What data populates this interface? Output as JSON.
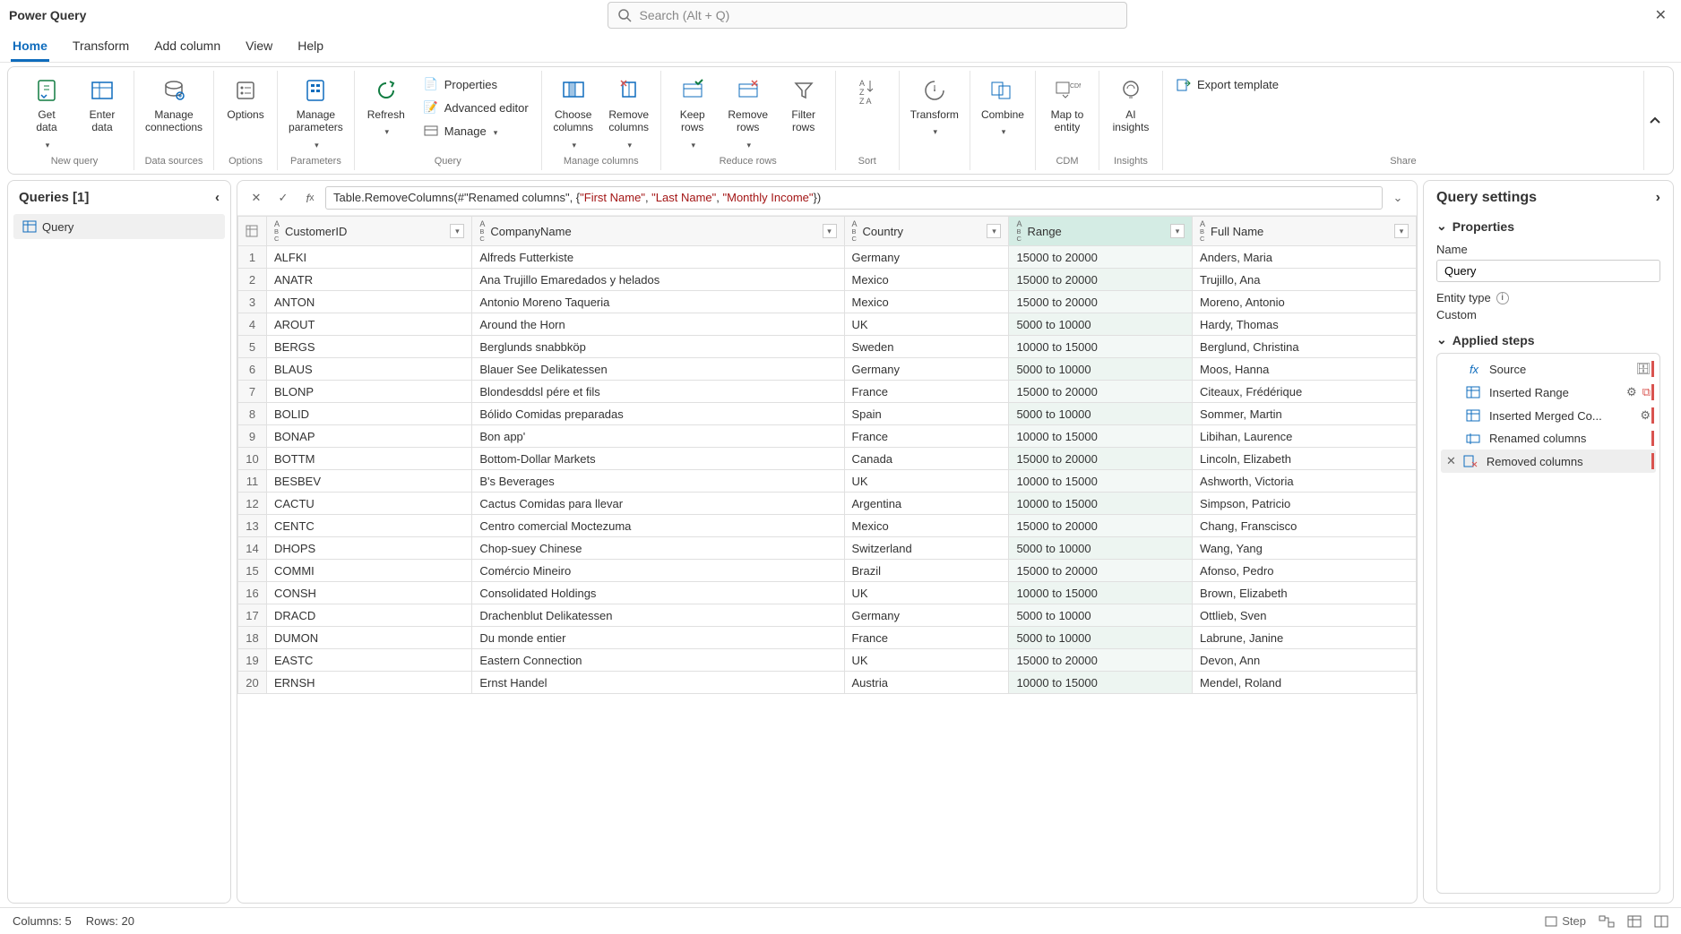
{
  "window": {
    "title": "Power Query"
  },
  "search": {
    "placeholder": "Search (Alt + Q)"
  },
  "tabs": [
    {
      "label": "Home",
      "active": true
    },
    {
      "label": "Transform",
      "active": false
    },
    {
      "label": "Add column",
      "active": false
    },
    {
      "label": "View",
      "active": false
    },
    {
      "label": "Help",
      "active": false
    }
  ],
  "ribbon": {
    "groups": {
      "new_query": {
        "label": "New query",
        "buttons": {
          "get_data": "Get\ndata",
          "enter_data": "Enter\ndata"
        }
      },
      "data_sources": {
        "label": "Data sources",
        "buttons": {
          "manage_connections": "Manage\nconnections"
        }
      },
      "options": {
        "label": "Options",
        "buttons": {
          "options": "Options"
        }
      },
      "parameters": {
        "label": "Parameters",
        "buttons": {
          "manage_parameters": "Manage\nparameters"
        }
      },
      "query": {
        "label": "Query",
        "buttons": {
          "refresh": "Refresh"
        },
        "minis": {
          "properties": "Properties",
          "advanced_editor": "Advanced editor",
          "manage": "Manage"
        }
      },
      "manage_columns": {
        "label": "Manage columns",
        "buttons": {
          "choose_columns": "Choose\ncolumns",
          "remove_columns": "Remove\ncolumns"
        }
      },
      "reduce_rows": {
        "label": "Reduce rows",
        "buttons": {
          "keep_rows": "Keep\nrows",
          "remove_rows": "Remove\nrows",
          "filter_rows": "Filter\nrows"
        }
      },
      "sort": {
        "label": "Sort"
      },
      "transform": {
        "label": "",
        "buttons": {
          "transform": "Transform"
        }
      },
      "combine": {
        "label": "",
        "buttons": {
          "combine": "Combine"
        }
      },
      "cdm": {
        "label": "CDM",
        "buttons": {
          "map_to_entity": "Map to\nentity"
        }
      },
      "insights": {
        "label": "Insights",
        "buttons": {
          "ai_insights": "AI\ninsights"
        }
      },
      "share": {
        "label": "Share",
        "buttons": {
          "export_template": "Export template"
        }
      }
    }
  },
  "queries_panel": {
    "title": "Queries [1]",
    "items": [
      {
        "name": "Query"
      }
    ]
  },
  "formula": {
    "prefix": "Table.RemoveColumns(#\"Renamed columns\", {",
    "args": [
      "\"First Name\"",
      "\"Last Name\"",
      "\"Monthly Income\""
    ],
    "suffix": "})"
  },
  "columns": [
    "CustomerID",
    "CompanyName",
    "Country",
    "Range",
    "Full Name"
  ],
  "rows": [
    [
      "ALFKI",
      "Alfreds Futterkiste",
      "Germany",
      "15000 to 20000",
      "Anders, Maria"
    ],
    [
      "ANATR",
      "Ana Trujillo Emaredados y helados",
      "Mexico",
      "15000 to 20000",
      "Trujillo, Ana"
    ],
    [
      "ANTON",
      "Antonio Moreno Taqueria",
      "Mexico",
      "15000 to 20000",
      "Moreno, Antonio"
    ],
    [
      "AROUT",
      "Around the Horn",
      "UK",
      "5000 to 10000",
      "Hardy, Thomas"
    ],
    [
      "BERGS",
      "Berglunds snabbköp",
      "Sweden",
      "10000 to 15000",
      "Berglund, Christina"
    ],
    [
      "BLAUS",
      "Blauer See Delikatessen",
      "Germany",
      "5000 to 10000",
      "Moos, Hanna"
    ],
    [
      "BLONP",
      "Blondesddsl pére et fils",
      "France",
      "15000 to 20000",
      "Citeaux, Frédérique"
    ],
    [
      "BOLID",
      "Bólido Comidas preparadas",
      "Spain",
      "5000 to 10000",
      "Sommer, Martin"
    ],
    [
      "BONAP",
      "Bon app'",
      "France",
      "10000 to 15000",
      "Libihan, Laurence"
    ],
    [
      "BOTTM",
      "Bottom-Dollar Markets",
      "Canada",
      "15000 to 20000",
      "Lincoln, Elizabeth"
    ],
    [
      "BESBEV",
      "B's Beverages",
      "UK",
      "10000 to 15000",
      "Ashworth, Victoria"
    ],
    [
      "CACTU",
      "Cactus Comidas para llevar",
      "Argentina",
      "10000 to 15000",
      "Simpson, Patricio"
    ],
    [
      "CENTC",
      "Centro comercial Moctezuma",
      "Mexico",
      "15000 to 20000",
      "Chang, Franscisco"
    ],
    [
      "DHOPS",
      "Chop-suey Chinese",
      "Switzerland",
      "5000 to 10000",
      "Wang, Yang"
    ],
    [
      "COMMI",
      "Comércio Mineiro",
      "Brazil",
      "15000 to 20000",
      "Afonso, Pedro"
    ],
    [
      "CONSH",
      "Consolidated Holdings",
      "UK",
      "10000 to 15000",
      "Brown, Elizabeth"
    ],
    [
      "DRACD",
      "Drachenblut Delikatessen",
      "Germany",
      "5000 to 10000",
      "Ottlieb, Sven"
    ],
    [
      "DUMON",
      "Du monde entier",
      "France",
      "5000 to 10000",
      "Labrune, Janine"
    ],
    [
      "EASTC",
      "Eastern Connection",
      "UK",
      "15000 to 20000",
      "Devon, Ann"
    ],
    [
      "ERNSH",
      "Ernst Handel",
      "Austria",
      "10000 to 15000",
      "Mendel, Roland"
    ]
  ],
  "settings": {
    "title": "Query settings",
    "properties_label": "Properties",
    "name_label": "Name",
    "name_value": "Query",
    "entity_type_label": "Entity type",
    "entity_type_value": "Custom",
    "applied_steps_label": "Applied steps",
    "steps": [
      {
        "name": "Source",
        "icon": "fx",
        "gear": false,
        "trailing": "db"
      },
      {
        "name": "Inserted Range",
        "icon": "table",
        "gear": true,
        "trailing": "warn"
      },
      {
        "name": "Inserted Merged Co...",
        "icon": "table",
        "gear": true,
        "trailing": ""
      },
      {
        "name": "Renamed columns",
        "icon": "rename",
        "gear": false,
        "trailing": ""
      },
      {
        "name": "Removed columns",
        "icon": "remove",
        "gear": false,
        "trailing": "",
        "selected": true,
        "x": true
      }
    ]
  },
  "status": {
    "columns_label": "Columns: 5",
    "rows_label": "Rows: 20",
    "step_label": "Step"
  }
}
